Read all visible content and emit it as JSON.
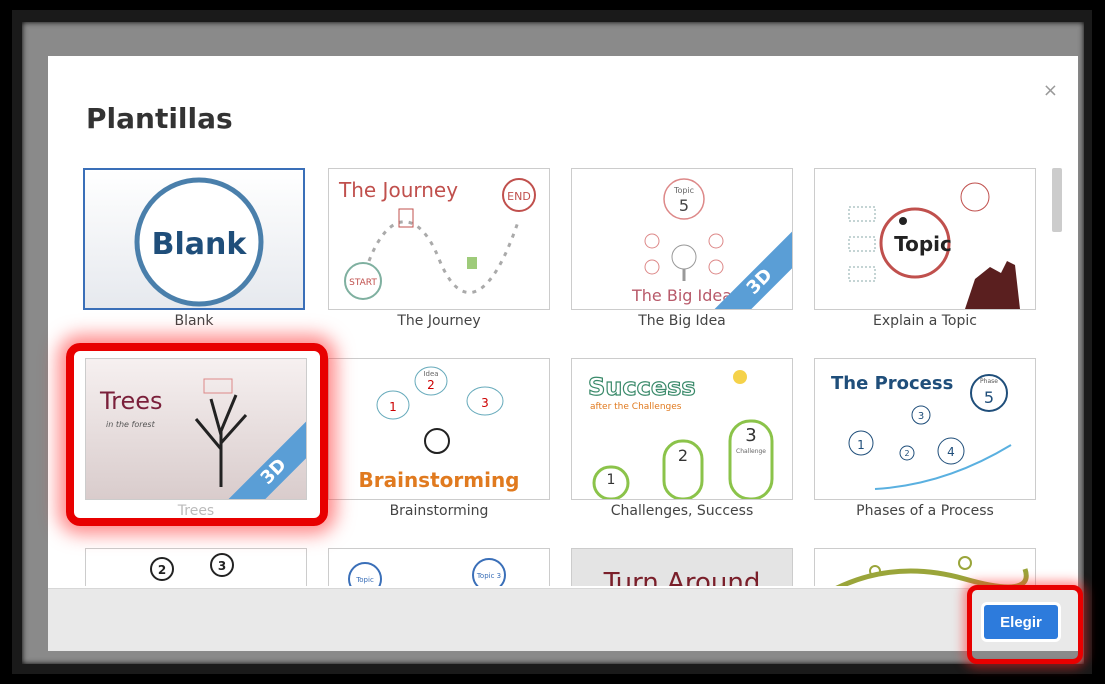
{
  "dialog": {
    "title": "Plantillas",
    "close_symbol": "×",
    "choose_label": "Elegir"
  },
  "templates": [
    {
      "label": "Blank",
      "thumb_text": "Blank"
    },
    {
      "label": "The Journey",
      "thumb_text": "The Journey",
      "extra": [
        "END",
        "START"
      ]
    },
    {
      "label": "The Big Idea",
      "thumb_text": "The Big Idea",
      "badge": "3D",
      "extra": [
        "Topic",
        "5"
      ]
    },
    {
      "label": "Explain a Topic",
      "thumb_text": "Topic"
    },
    {
      "label": "Trees",
      "thumb_text": "Trees",
      "subtitle": "in the forest",
      "badge": "3D"
    },
    {
      "label": "Brainstorming",
      "thumb_text": "Brainstorming",
      "extra": [
        "Idea",
        "1",
        "2",
        "3"
      ]
    },
    {
      "label": "Challenges, Success",
      "thumb_text": "Success",
      "subtitle": "after the Challenges",
      "extra": [
        "1",
        "2",
        "3",
        "Challenge"
      ]
    },
    {
      "label": "Phases of a Process",
      "thumb_text": "The Process",
      "extra": [
        "Phase",
        "1",
        "2",
        "3",
        "4",
        "5"
      ]
    },
    {
      "label": "",
      "extra": [
        "2",
        "3"
      ]
    },
    {
      "label": "",
      "extra": [
        "Topic",
        "Topic 3"
      ]
    },
    {
      "label": "",
      "thumb_text": "Turn Around"
    },
    {
      "label": ""
    }
  ],
  "colors": {
    "accent": "#2d7bdc",
    "highlight": "#e80000",
    "blank_ring": "#4a7fab"
  }
}
